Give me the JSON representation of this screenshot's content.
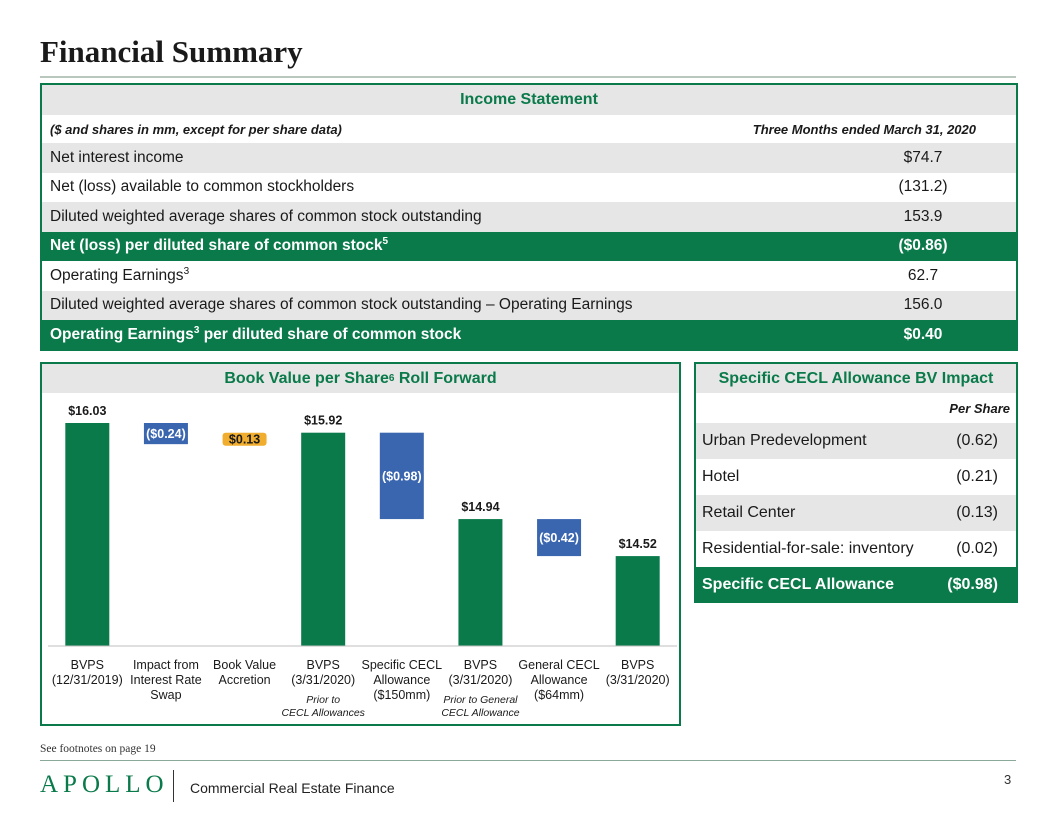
{
  "page": {
    "title": "Financial Summary",
    "footnote": "See footnotes on page 19",
    "logo": "APOLLO",
    "subbrand": "Commercial Real Estate Finance",
    "page_number": "3"
  },
  "income_statement": {
    "title": "Income Statement",
    "subhead_left": "($ and shares in mm, except for per share data)",
    "subhead_right": "Three Months ended March 31, 2020",
    "rows": [
      {
        "label": "Net interest income",
        "sup": "",
        "label_tail": "",
        "value": "$74.7",
        "style": "gray"
      },
      {
        "label": "Net (loss) available to common stockholders",
        "sup": "",
        "label_tail": "",
        "value": "(131.2)",
        "style": "white"
      },
      {
        "label": "Diluted weighted average shares of common stock outstanding",
        "sup": "",
        "label_tail": "",
        "value": "153.9",
        "style": "gray"
      },
      {
        "label": "Net (loss) per diluted share of common stock",
        "sup": "5",
        "label_tail": "",
        "value": "($0.86)",
        "style": "green"
      },
      {
        "label": "Operating Earnings",
        "sup": "3",
        "label_tail": "",
        "value": "62.7",
        "style": "white"
      },
      {
        "label": "Diluted weighted average shares of common stock outstanding – Operating Earnings",
        "sup": "",
        "label_tail": "",
        "value": "156.0",
        "style": "gray"
      },
      {
        "label": "Operating Earnings",
        "sup": "3",
        "label_tail": " per diluted share of common stock",
        "value": "$0.40",
        "style": "green"
      }
    ]
  },
  "book_value": {
    "title_main": "Book Value per Share",
    "title_sup": "6",
    "title_tail": " Roll Forward"
  },
  "chart_data": {
    "type": "bar",
    "subtype": "waterfall",
    "ylim": [
      0,
      16.03
    ],
    "bars": [
      {
        "kind": "total",
        "start": 0,
        "end": 16.03,
        "label": "$16.03",
        "color": "#0a7a4a",
        "category": [
          "BVPS",
          "(12/31/2019)"
        ],
        "note": []
      },
      {
        "kind": "delta",
        "start": 16.03,
        "end": 15.79,
        "label": "($0.24)",
        "color": "#3a66b0",
        "category": [
          "Impact from",
          "Interest Rate",
          "Swap"
        ],
        "note": []
      },
      {
        "kind": "delta",
        "start": 15.79,
        "end": 15.92,
        "label": "$0.13",
        "color": "#f0ad2e",
        "category": [
          "Book Value",
          "Accretion"
        ],
        "note": []
      },
      {
        "kind": "total",
        "start": 0,
        "end": 15.92,
        "label": "$15.92",
        "color": "#0a7a4a",
        "category": [
          "BVPS",
          "(3/31/2020)"
        ],
        "note": [
          "Prior to",
          "CECL Allowances"
        ]
      },
      {
        "kind": "delta",
        "start": 15.92,
        "end": 14.94,
        "label": "($0.98)",
        "color": "#3a66b0",
        "category": [
          "Specific CECL",
          "Allowance",
          "($150mm)"
        ],
        "note": []
      },
      {
        "kind": "total",
        "start": 0,
        "end": 14.94,
        "label": "$14.94",
        "color": "#0a7a4a",
        "category": [
          "BVPS",
          "(3/31/2020)"
        ],
        "note": [
          "Prior to General",
          "CECL Allowance"
        ]
      },
      {
        "kind": "delta",
        "start": 14.94,
        "end": 14.52,
        "label": "($0.42)",
        "color": "#3a66b0",
        "category": [
          "General CECL",
          "Allowance",
          "($64mm)"
        ],
        "note": []
      },
      {
        "kind": "total",
        "start": 0,
        "end": 14.52,
        "label": "$14.52",
        "color": "#0a7a4a",
        "category": [
          "BVPS",
          "(3/31/2020)"
        ],
        "note": []
      }
    ]
  },
  "cecl": {
    "title": "Specific CECL Allowance BV Impact",
    "col_head": "Per Share",
    "rows": [
      {
        "label": "Urban Predevelopment",
        "value": "(0.62)",
        "style": "gray"
      },
      {
        "label": "Hotel",
        "value": "(0.21)",
        "style": "white"
      },
      {
        "label": "Retail Center",
        "value": "(0.13)",
        "style": "gray"
      },
      {
        "label": "Residential-for-sale: inventory",
        "value": "(0.02)",
        "style": "white"
      },
      {
        "label": "Specific CECL Allowance",
        "value": "($0.98)",
        "style": "green"
      }
    ]
  }
}
